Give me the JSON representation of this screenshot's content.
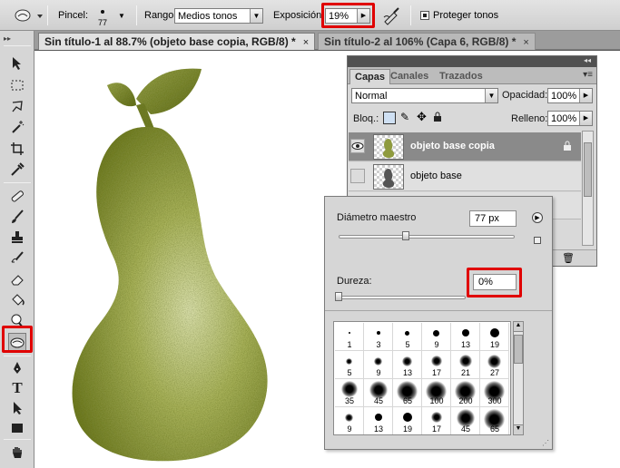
{
  "options_bar": {
    "brush_label": "Pincel:",
    "brush_size": "77",
    "range_label": "Rango",
    "range_value": "Medios tonos",
    "exposure_label": "Exposición:",
    "exposure_value": "19%",
    "protect_tones_label": "Proteger tonos",
    "protect_tones_checked": true
  },
  "tabs": [
    {
      "label": "Sin título-1 al 88.7% (objeto base copia, RGB/8) *",
      "close": "×"
    },
    {
      "label": "Sin título-2 al 106% (Capa 6, RGB/8) *",
      "close": "×"
    }
  ],
  "layers_panel": {
    "tabs": [
      "Capas",
      "Canales",
      "Trazados"
    ],
    "blend_mode": "Normal",
    "opacity_label": "Opacidad:",
    "opacity_value": "100%",
    "lock_label": "Bloq.:",
    "fill_label": "Relleno:",
    "fill_value": "100%",
    "layers": [
      {
        "name": "objeto base copia",
        "visible": true,
        "selected": true
      },
      {
        "name": "objeto base",
        "visible": false,
        "selected": false
      }
    ]
  },
  "brush_picker": {
    "diameter_label": "Diámetro maestro",
    "diameter_value": "77 px",
    "hardness_label": "Dureza:",
    "hardness_value": "0%",
    "presets": [
      {
        "size": "1",
        "hard": true
      },
      {
        "size": "3",
        "hard": true
      },
      {
        "size": "5",
        "hard": true
      },
      {
        "size": "9",
        "hard": true
      },
      {
        "size": "13",
        "hard": true
      },
      {
        "size": "19",
        "hard": true
      },
      {
        "size": "5",
        "hard": false
      },
      {
        "size": "9",
        "hard": false
      },
      {
        "size": "13",
        "hard": false
      },
      {
        "size": "17",
        "hard": false
      },
      {
        "size": "21",
        "hard": false
      },
      {
        "size": "27",
        "hard": false
      },
      {
        "size": "35",
        "hard": false
      },
      {
        "size": "45",
        "hard": false
      },
      {
        "size": "65",
        "hard": false
      },
      {
        "size": "100",
        "hard": false
      },
      {
        "size": "200",
        "hard": false
      },
      {
        "size": "300",
        "hard": false
      },
      {
        "size": "9",
        "hard": false
      },
      {
        "size": "13",
        "hard": true
      },
      {
        "size": "19",
        "hard": true
      },
      {
        "size": "17",
        "hard": false
      },
      {
        "size": "45",
        "hard": false
      },
      {
        "size": "65",
        "hard": false
      }
    ]
  },
  "colors": {
    "highlight_red": "#e00000",
    "pear_light": "#d9dfa0",
    "pear_mid": "#9aa64a",
    "pear_dark": "#5e6a1e"
  }
}
